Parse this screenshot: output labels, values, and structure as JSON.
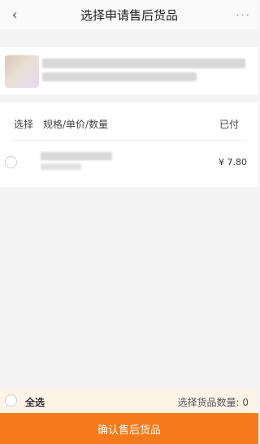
{
  "header": {
    "title": "选择申请售后货品",
    "back_icon": "chevron-left-icon",
    "more_icon": "more-horizontal-icon",
    "back_glyph": "‹",
    "more_glyph": "···"
  },
  "store": {
    "avatar_icon": "store-avatar"
  },
  "list": {
    "col_select": "选择",
    "col_spec": "规格/单价/数量",
    "col_paid": "已付",
    "items": [
      {
        "price": "¥ 7.80",
        "checked": false
      }
    ]
  },
  "footer": {
    "select_all": "全选",
    "count_label": "选择货品数量: 0",
    "confirm_label": "确认售后货品"
  },
  "colors": {
    "accent": "#f77a1a",
    "bar_bg": "#fdf3e6"
  }
}
